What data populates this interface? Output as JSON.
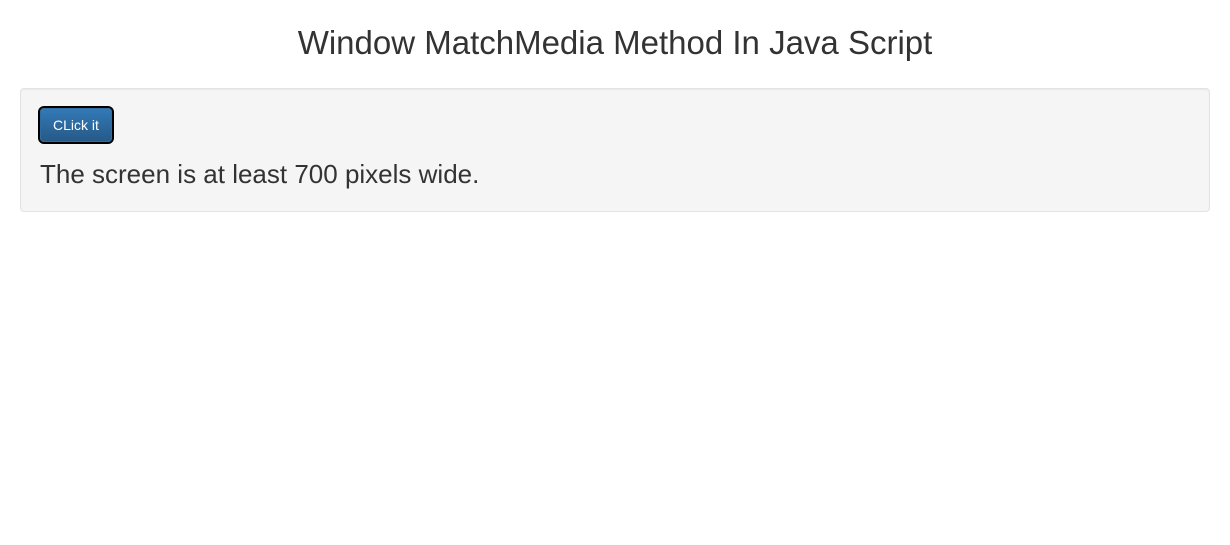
{
  "header": {
    "title": "Window MatchMedia Method In Java Script"
  },
  "well": {
    "button_label": "CLick it",
    "result_text": "The screen is at least 700 pixels wide."
  }
}
